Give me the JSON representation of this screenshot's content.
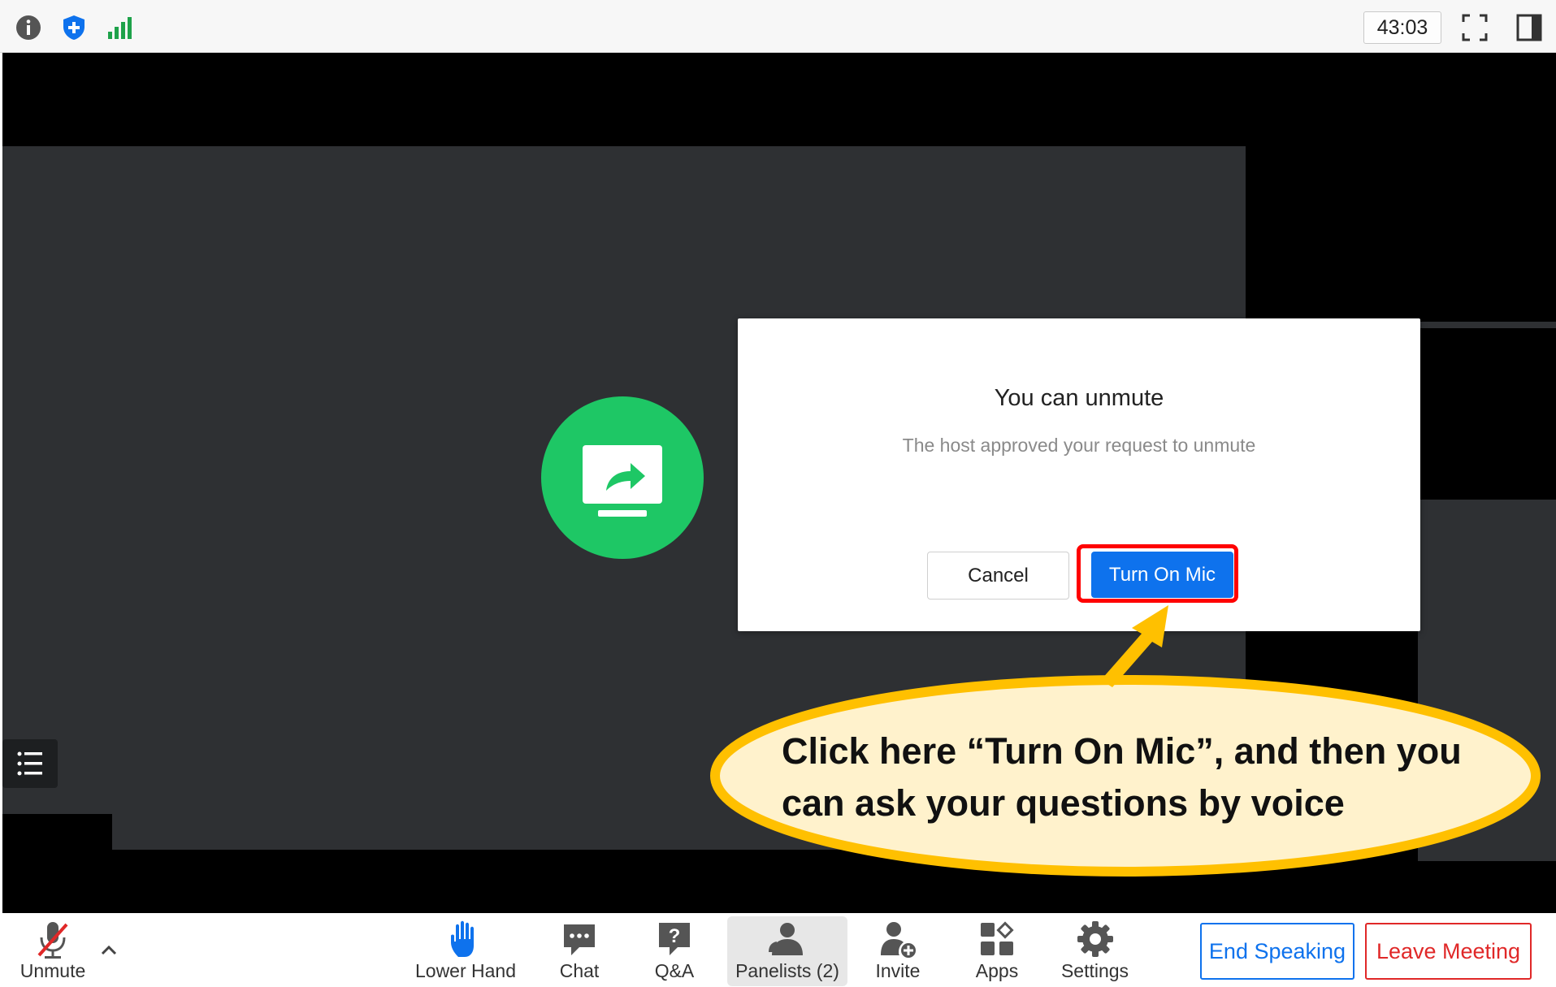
{
  "topbar": {
    "timer": "43:03",
    "icons": [
      "info-icon",
      "shield-icon",
      "signal-icon",
      "fullscreen-icon",
      "sidebar-icon"
    ]
  },
  "dialog": {
    "title": "You can unmute",
    "subtitle": "The host approved your request to unmute",
    "cancel_label": "Cancel",
    "confirm_label": "Turn On Mic"
  },
  "callout": {
    "line1": "Click here “Turn On Mic”, and then you",
    "line2": "can ask your questions by voice"
  },
  "toolbar": {
    "unmute_label": "Unmute",
    "lower_hand_label": "Lower Hand",
    "chat_label": "Chat",
    "qa_label": "Q&A",
    "panelists_label": "Panelists (2)",
    "invite_label": "Invite",
    "apps_label": "Apps",
    "settings_label": "Settings",
    "end_speaking_label": "End Speaking",
    "leave_meeting_label": "Leave Meeting"
  },
  "colors": {
    "accent_blue": "#0e72ed",
    "share_green": "#1ec765",
    "leave_red": "#e02828",
    "callout_fill": "#fff2cc",
    "callout_stroke": "#ffc000"
  }
}
